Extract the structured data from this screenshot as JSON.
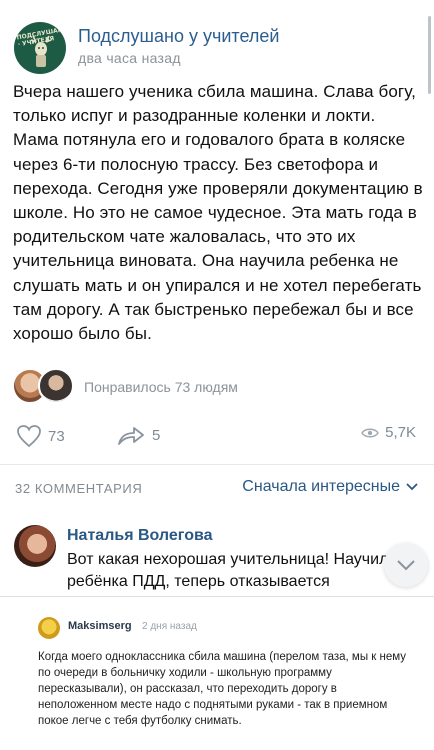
{
  "post": {
    "group_name": "Подслушано у учителей",
    "time": "два часа назад",
    "avatar_text": "ПОДСЛУШАНО · УЧИТЕЛЯ",
    "text": "Вчера нашего ученика сбила машина. Слава богу, только испуг и разодранные коленки и локти. Мама потянула его и годовалого брата в коляске через 6-ти полосную трассу. Без светофора и перехода. Сегодня уже проверяли документацию в школе. Но это не самое чудесное. Эта мать года в родительском чате жаловалась, что это их учительница виновата. Она научила ребенка не слушать мать и он упирался и не хотел перебегать там дорогу. А так быстренько перебежал бы и все хорошо было бы.",
    "likers_text": "Понравилось 73 людям",
    "likes": "73",
    "shares": "5",
    "views": "5,7K"
  },
  "comments": {
    "count_label": "32 КОММЕНТАРИЯ",
    "sort_label": "Сначала интересные",
    "first": {
      "author": "Наталья Волегова",
      "line1": "Вот какая нехорошая учительница! Научила",
      "line2": "ребёнка ПДД, теперь отказывается"
    }
  },
  "embedded": {
    "author": "Maksimserg",
    "time": "2 дня назад",
    "text": "Когда моего одноклассника сбила машина (перелом таза, мы к нему по очереди в больничку ходили - школьную программу пересказывали), он рассказал, что переходить дорогу в неположенном месте надо с поднятыми руками - так в приемном покое легче с тебя футболку снимать."
  },
  "colors": {
    "link": "#2a5885",
    "muted": "#8c9399",
    "group_avatar": "#1d5b45"
  }
}
